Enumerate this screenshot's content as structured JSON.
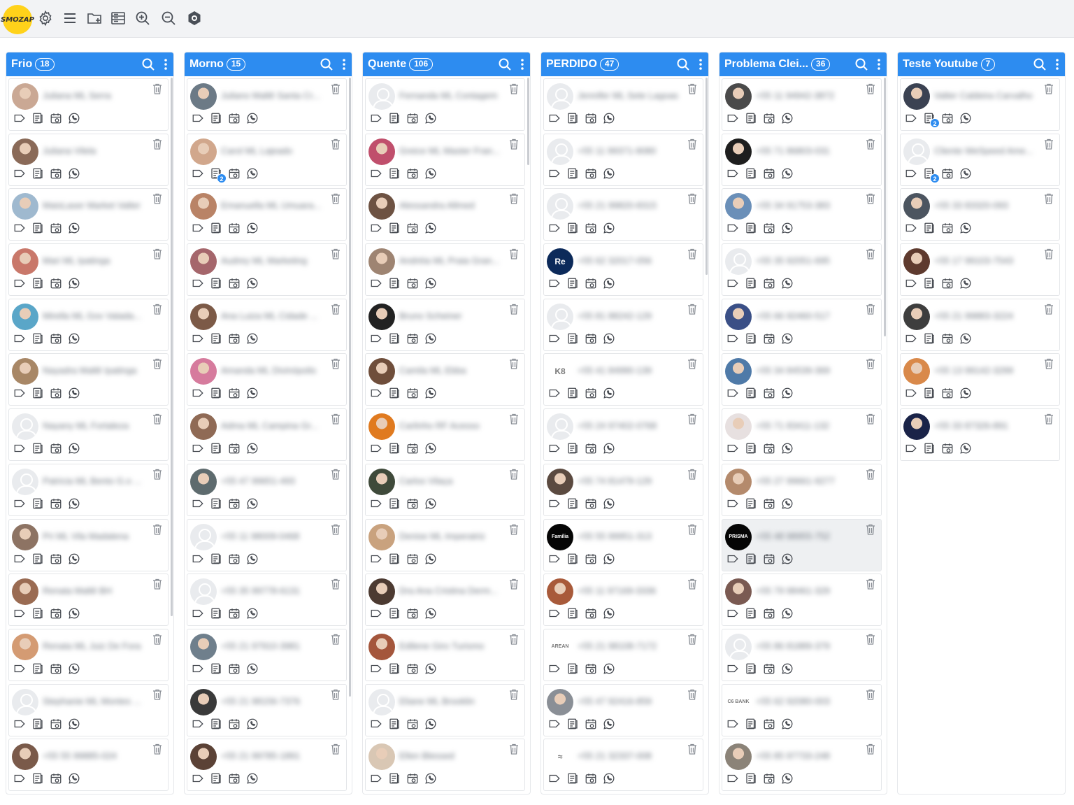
{
  "app": {
    "logo_text": "SMOZAP"
  },
  "toolbar": {
    "icons": [
      "settings-icon",
      "menu-list-icon",
      "folder-add-icon",
      "board-view-icon",
      "zoom-in-icon",
      "zoom-out-icon",
      "brain-ai-icon"
    ]
  },
  "accent_color": "#2d8cf0",
  "columns": [
    {
      "title": "Frio",
      "count": "18",
      "cards": [
        {
          "name": "Juliana ML Serra",
          "avatar": "photo",
          "color": "#caa894"
        },
        {
          "name": "Juliana Vilela",
          "avatar": "photo",
          "color": "#8a6a58"
        },
        {
          "name": "MaisLaser Market Valter",
          "avatar": "photo",
          "color": "#9fb9cf"
        },
        {
          "name": "Mari ML Ipatinga",
          "avatar": "photo",
          "color": "#c9786a"
        },
        {
          "name": "Mirella ML Gov Valada...",
          "avatar": "photo",
          "color": "#5aa6c8"
        },
        {
          "name": "Nayadra Maltê Ipatinga",
          "avatar": "photo",
          "color": "#a88766"
        },
        {
          "name": "Nayany ML Fortaleza",
          "avatar": "default",
          "color": "#e9ebee"
        },
        {
          "name": "Patricia ML Bento G.o ...",
          "avatar": "default",
          "color": "#e9ebee"
        },
        {
          "name": "Pri ML Vila Madalena",
          "avatar": "photo",
          "color": "#8d7363"
        },
        {
          "name": "Renata Maltê BH",
          "avatar": "photo",
          "color": "#9a6b52"
        },
        {
          "name": "Renata ML Juiz De Fora",
          "avatar": "photo",
          "color": "#d49b73"
        },
        {
          "name": "Stephanie ML Montes ...",
          "avatar": "default",
          "color": "#e9ebee"
        },
        {
          "name": "+55 55 99885-024",
          "avatar": "photo",
          "color": "#7a5a4a"
        }
      ]
    },
    {
      "title": "Morno",
      "count": "15",
      "cards": [
        {
          "name": "Juliano Maltê Santa Cr...",
          "avatar": "photo",
          "color": "#6c7a86"
        },
        {
          "name": "Carol ML Lajeado",
          "avatar": "photo",
          "color": "#d1a78c",
          "badge": "2"
        },
        {
          "name": "Emanuella ML Umuara...",
          "avatar": "photo",
          "color": "#b98366"
        },
        {
          "name": "Audrey ML Marketing",
          "avatar": "photo",
          "color": "#a5666b"
        },
        {
          "name": "Ana Luiza ML Cidade ...",
          "avatar": "photo",
          "color": "#7c5a47"
        },
        {
          "name": "Amanda ML Divinópolis",
          "avatar": "photo",
          "color": "#d67b9d"
        },
        {
          "name": "Adma ML Campina Gr...",
          "avatar": "photo",
          "color": "#8f6a55"
        },
        {
          "name": "+55 47 99651-493",
          "avatar": "photo",
          "color": "#5e6b6e"
        },
        {
          "name": "+55 11 98009-0468",
          "avatar": "default",
          "color": "#e9ebee"
        },
        {
          "name": "+55 35 99778-6131",
          "avatar": "default",
          "color": "#e9ebee"
        },
        {
          "name": "+55 21 97910-3981",
          "avatar": "photo",
          "color": "#6f7f8c"
        },
        {
          "name": "+55 21 98156-7376",
          "avatar": "photo",
          "color": "#3a3a3a"
        },
        {
          "name": "+55 21 99785-1891",
          "avatar": "photo",
          "color": "#5b4236"
        }
      ]
    },
    {
      "title": "Quente",
      "count": "106",
      "cards": [
        {
          "name": "Fernanda ML Contagem",
          "avatar": "default",
          "color": "#e9ebee"
        },
        {
          "name": "Greice ML Master Fran...",
          "avatar": "photo",
          "color": "#c04f6c"
        },
        {
          "name": "Alessandra Allmed",
          "avatar": "photo",
          "color": "#6d5242"
        },
        {
          "name": "Andréia ML Praia Gran...",
          "avatar": "photo",
          "color": "#9e8472"
        },
        {
          "name": "Bruno Scheiner",
          "avatar": "photo",
          "color": "#222222"
        },
        {
          "name": "Camila ML Ebba",
          "avatar": "photo",
          "color": "#6f4e3b"
        },
        {
          "name": "Carlinho RF Acesso",
          "avatar": "photo",
          "color": "#e07a1f"
        },
        {
          "name": "Carlos Vilaça",
          "avatar": "photo",
          "color": "#3f4a3a"
        },
        {
          "name": "Denise ML Imperatriz",
          "avatar": "photo",
          "color": "#c9a27e"
        },
        {
          "name": "Dra Ana Cristina Derm...",
          "avatar": "photo",
          "color": "#4c3a31"
        },
        {
          "name": "Edilene Giro Turismo",
          "avatar": "photo",
          "color": "#a4563c"
        },
        {
          "name": "Eliane ML Brooklin",
          "avatar": "default",
          "color": "#e9ebee"
        },
        {
          "name": "Ellen Blessed",
          "avatar": "photo",
          "color": "#d9c7b4"
        }
      ]
    },
    {
      "title": "PERDIDO",
      "count": "47",
      "cards": [
        {
          "name": "Jennifer ML Sete Lagoas",
          "avatar": "default",
          "color": "#e9ebee"
        },
        {
          "name": "+55 11 99371-9080",
          "avatar": "default",
          "color": "#e9ebee"
        },
        {
          "name": "+55 21 99820-8315",
          "avatar": "default",
          "color": "#e9ebee"
        },
        {
          "name": "+55 62 32017-056",
          "avatar": "logo",
          "color": "#0c2a5a",
          "logo": "Re"
        },
        {
          "name": "+55 81 88242-129",
          "avatar": "default",
          "color": "#e9ebee"
        },
        {
          "name": "+55 41 84990-139",
          "avatar": "logo",
          "color": "#ffffff",
          "logo": "K8"
        },
        {
          "name": "+55 24 97402-0768",
          "avatar": "default",
          "color": "#e9ebee"
        },
        {
          "name": "+55 74 81479-129",
          "avatar": "photo",
          "color": "#5b4a40"
        },
        {
          "name": "+55 55 99951-313",
          "avatar": "logo",
          "color": "#050505",
          "logo": "Família"
        },
        {
          "name": "+55 11 97169-3336",
          "avatar": "photo",
          "color": "#a85a3a"
        },
        {
          "name": "+55 21 98108-7172",
          "avatar": "logo",
          "color": "#ffffff",
          "logo": "AREAN"
        },
        {
          "name": "+55 47 92416-859",
          "avatar": "photo",
          "color": "#8a8f96"
        },
        {
          "name": "+55 21 32337-008",
          "avatar": "logo",
          "color": "#ffffff",
          "logo": "≈"
        }
      ]
    },
    {
      "title": "Problema Clei...",
      "count": "36",
      "cards": [
        {
          "name": "+55 11 94942-3872",
          "avatar": "photo",
          "color": "#4a4a4a"
        },
        {
          "name": "+55 71 86803-031",
          "avatar": "photo",
          "color": "#1e1e1e"
        },
        {
          "name": "+55 34 91753-383",
          "avatar": "photo",
          "color": "#6a8fb8"
        },
        {
          "name": "+55 35 92051-695",
          "avatar": "default",
          "color": "#e9ebee"
        },
        {
          "name": "+55 66 92460-517",
          "avatar": "photo",
          "color": "#3a4f86"
        },
        {
          "name": "+55 34 84539-369",
          "avatar": "photo",
          "color": "#4f7aa8"
        },
        {
          "name": "+55 71 83411-132",
          "avatar": "photo",
          "color": "#e7e0e0"
        },
        {
          "name": "+55 27 99661-9277",
          "avatar": "photo",
          "color": "#b48a6c"
        },
        {
          "name": "+55 48 98955-752",
          "avatar": "logo",
          "color": "#050505",
          "logo": "PRISMA",
          "highlight": true
        },
        {
          "name": "+55 79 98461-329",
          "avatar": "photo",
          "color": "#7a5a52"
        },
        {
          "name": "+55 86 81889-379",
          "avatar": "default",
          "color": "#e9ebee"
        },
        {
          "name": "+55 62 92080-003",
          "avatar": "logo",
          "color": "#ffffff",
          "logo": "C6 BANK"
        },
        {
          "name": "+55 85 97733-248",
          "avatar": "photo",
          "color": "#8b8378"
        }
      ]
    },
    {
      "title": "Teste Youtube",
      "count": "7",
      "cards": [
        {
          "name": "Valter Caldeira Carvalho",
          "avatar": "photo",
          "color": "#3b4252",
          "badge": "2"
        },
        {
          "name": "Cliente WeSpeed Ame...",
          "avatar": "default",
          "color": "#e9ebee",
          "badge": "2"
        },
        {
          "name": "+55 33 83320-093",
          "avatar": "photo",
          "color": "#4c5560"
        },
        {
          "name": "+55 17 99103-7543",
          "avatar": "photo",
          "color": "#5e3a2e"
        },
        {
          "name": "+55 21 99883-3224",
          "avatar": "photo",
          "color": "#3e3e3e"
        },
        {
          "name": "+55 13 99142-3299",
          "avatar": "photo",
          "color": "#d9894a"
        },
        {
          "name": "+55 33 87326-891",
          "avatar": "photo",
          "color": "#1a2348"
        }
      ]
    }
  ]
}
